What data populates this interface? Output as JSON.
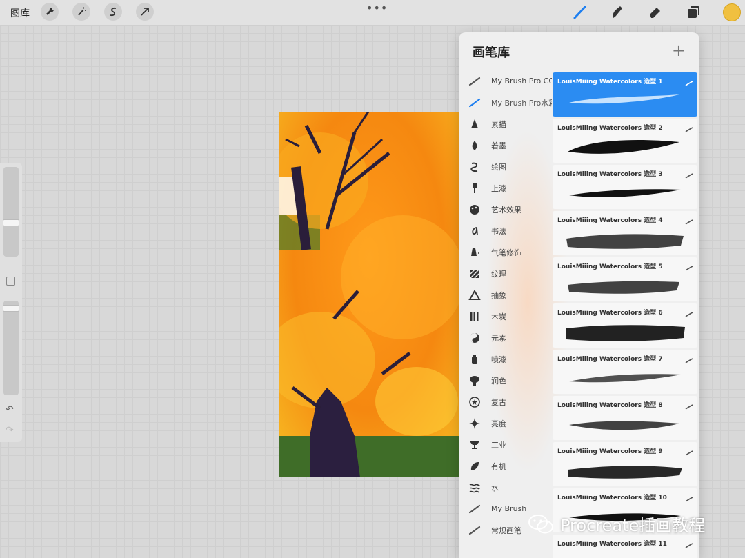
{
  "topbar": {
    "gallery_label": "图库",
    "more": "•••",
    "tools_left": [
      "wrench-icon",
      "magic-wand-icon",
      "selection-icon",
      "transform-arrow-icon"
    ],
    "tools_right": [
      "brush-icon",
      "smudge-icon",
      "eraser-icon",
      "layers-icon"
    ],
    "active_color": "#f0c040"
  },
  "panel": {
    "title": "画笔库",
    "add": "+",
    "categories": [
      {
        "label": "My Brush Pro CG",
        "icon": "brush-stroke-icon"
      },
      {
        "label": "My Brush Pro水彩",
        "icon": "brush-stroke-icon",
        "active": true
      },
      {
        "label": "素描",
        "icon": "pencil-tip-icon"
      },
      {
        "label": "着墨",
        "icon": "ink-drop-icon"
      },
      {
        "label": "绘图",
        "icon": "squiggle-icon"
      },
      {
        "label": "上漆",
        "icon": "paint-brush-icon"
      },
      {
        "label": "艺术效果",
        "icon": "palette-icon"
      },
      {
        "label": "书法",
        "icon": "calligraphy-icon"
      },
      {
        "label": "气笔修饰",
        "icon": "airbrush-icon"
      },
      {
        "label": "纹理",
        "icon": "texture-icon"
      },
      {
        "label": "抽象",
        "icon": "triangle-icon"
      },
      {
        "label": "木炭",
        "icon": "charcoal-icon"
      },
      {
        "label": "元素",
        "icon": "yin-yang-icon"
      },
      {
        "label": "喷漆",
        "icon": "spray-can-icon"
      },
      {
        "label": "润色",
        "icon": "blender-icon"
      },
      {
        "label": "复古",
        "icon": "retro-star-icon"
      },
      {
        "label": "亮度",
        "icon": "sparkle-icon"
      },
      {
        "label": "工业",
        "icon": "anvil-icon"
      },
      {
        "label": "有机",
        "icon": "leaf-icon"
      },
      {
        "label": "水",
        "icon": "waves-icon"
      },
      {
        "label": "My Brush",
        "icon": "brush-stroke-icon"
      },
      {
        "label": "常规画笔",
        "icon": "brush-stroke-icon"
      }
    ],
    "brushes": [
      {
        "name": "LouisMiiing Watercolors 造型 1",
        "selected": true
      },
      {
        "name": "LouisMiiing Watercolors 造型 2"
      },
      {
        "name": "LouisMiiing Watercolors 造型 3"
      },
      {
        "name": "LouisMiiing Watercolors 造型 4"
      },
      {
        "name": "LouisMiiing Watercolors 造型 5"
      },
      {
        "name": "LouisMiiing Watercolors 造型 6"
      },
      {
        "name": "LouisMiiing Watercolors 造型 7"
      },
      {
        "name": "LouisMiiing Watercolors 造型 8"
      },
      {
        "name": "LouisMiiing Watercolors 造型 9"
      },
      {
        "name": "LouisMiiing Watercolors 造型 10"
      },
      {
        "name": "LouisMiiing Watercolors 造型 11"
      }
    ]
  },
  "watermark": {
    "text": "Procreate插画教程"
  },
  "colors": {
    "selected_brush": "#2b8cf2",
    "accent_blue": "#1e7ff0"
  }
}
